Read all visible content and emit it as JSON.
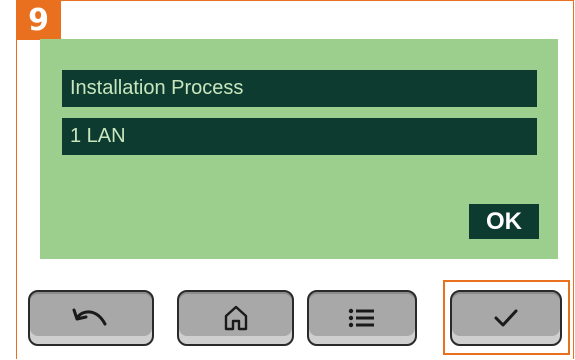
{
  "step": {
    "number": "9"
  },
  "screen": {
    "title": "Installation Process",
    "selected_item": "1 LAN",
    "ok_label": "OK"
  },
  "buttons": [
    {
      "icon": "back-arrow-icon"
    },
    {
      "icon": "home-icon"
    },
    {
      "icon": "menu-list-icon"
    },
    {
      "icon": "checkmark-icon",
      "highlighted": true
    }
  ],
  "colors": {
    "accent": "#e8701e",
    "screen_bg": "#9ccf8e",
    "bar_bg": "#0e3b30",
    "bar_text": "#c8e6bd",
    "button_bg": "#a8a8a8"
  }
}
